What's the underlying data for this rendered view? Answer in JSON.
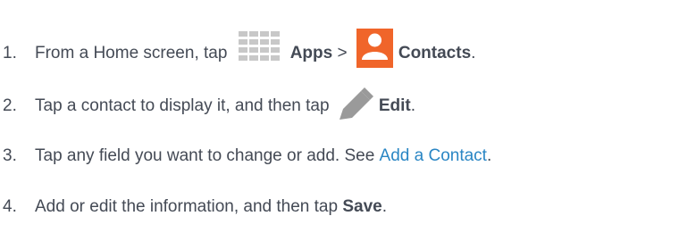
{
  "steps": [
    {
      "number": "1.",
      "text_before": "From a Home screen, tap ",
      "apps_label": "Apps",
      "separator": " > ",
      "contacts_label": "Contacts",
      "end": ".",
      "icons": [
        "apps-grid-icon",
        "contacts-icon"
      ],
      "icon_colors": {
        "apps": "#c8c8c8",
        "contacts": "#f0652a"
      }
    },
    {
      "number": "2.",
      "text_before": "Tap a contact to display it, and then tap ",
      "edit_label": "Edit",
      "end": ".",
      "icons": [
        "edit-pencil-icon"
      ],
      "icon_colors": {
        "edit": "#9a9a9a"
      }
    },
    {
      "number": "3.",
      "text_before": "Tap any field you want to change or add. See ",
      "link_text": "Add a Contact",
      "end": ".",
      "link_color": "#2a86c4"
    },
    {
      "number": "4.",
      "text_before": "Add or edit the information, and then tap ",
      "save_label": "Save",
      "end": "."
    }
  ],
  "colors": {
    "text": "#444a55",
    "link": "#2a86c4"
  }
}
